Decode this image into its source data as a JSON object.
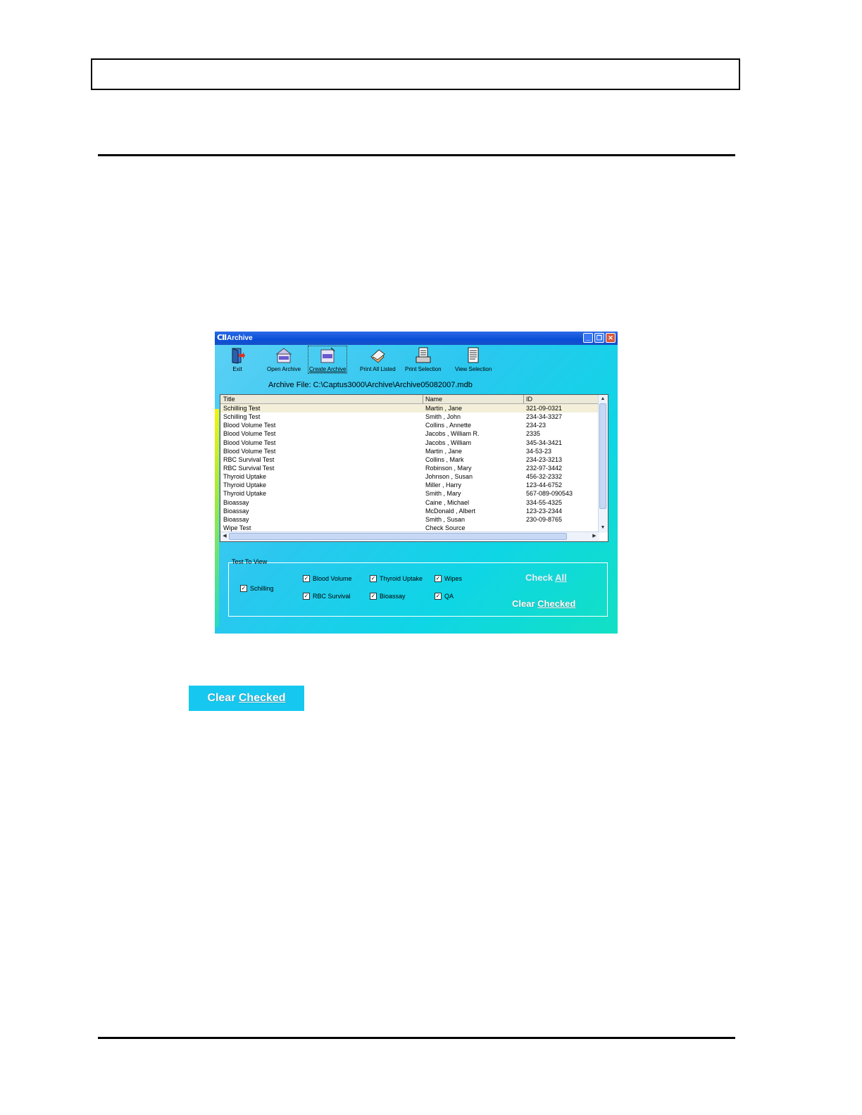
{
  "window": {
    "logo": "CII",
    "title": "Archive",
    "min_glyph": "_",
    "max_glyph": "❐",
    "close_glyph": "✕"
  },
  "toolbar": [
    {
      "label": "Exit",
      "icon": "exit-door-icon"
    },
    {
      "label": "Open Archive",
      "icon": "open-archive-icon"
    },
    {
      "label": "Create Archive",
      "icon": "create-archive-icon"
    },
    {
      "label": "Print All Listed",
      "icon": "print-all-icon"
    },
    {
      "label": "Print Selection",
      "icon": "print-selection-icon"
    },
    {
      "label": "View Selection",
      "icon": "view-selection-icon"
    }
  ],
  "archive_file": "Archive File: C:\\Captus3000\\Archive\\Archive05082007.mdb",
  "table": {
    "headers": [
      "Title",
      "Name",
      "ID"
    ],
    "rows": [
      [
        "Schilling Test",
        "Martin , Jane",
        "321-09-0321"
      ],
      [
        "Schilling Test",
        "Smith , John",
        "234-34-3327"
      ],
      [
        "Blood Volume Test",
        "Collins , Annette",
        "234-23"
      ],
      [
        "Blood Volume Test",
        "Jacobs , William R.",
        "2335"
      ],
      [
        "Blood Volume Test",
        "Jacobs , William",
        "345-34-3421"
      ],
      [
        "Blood Volume Test",
        "Martin , Jane",
        "34-53-23"
      ],
      [
        "RBC Survival Test",
        "Collins , Mark",
        "234-23-3213"
      ],
      [
        "RBC Survival Test",
        "Robinson , Mary",
        "232-97-3442"
      ],
      [
        "Thyroid Uptake",
        "Johnson , Susan",
        "456-32-2332"
      ],
      [
        "Thyroid Uptake",
        "Miller , Harry",
        "123-44-6752"
      ],
      [
        "Thyroid Uptake",
        "Smith , Mary",
        "567-089-090543"
      ],
      [
        "Bioassay",
        "Caine , Michael",
        "334-55-4325"
      ],
      [
        "Bioassay",
        "McDonald , Albert",
        "123-23-2344"
      ],
      [
        "Bioassay",
        "Smith , Susan",
        "230-09-8765"
      ],
      [
        "Wipe Test",
        "Check Source",
        ""
      ]
    ]
  },
  "test_to_view": {
    "label": "Test To View",
    "options": [
      {
        "label": "Schilling",
        "checked": true
      },
      {
        "label": "Blood Volume",
        "checked": true
      },
      {
        "label": "Thyroid Uptake",
        "checked": true
      },
      {
        "label": "Wipes",
        "checked": true
      },
      {
        "label": "RBC Survival",
        "checked": true
      },
      {
        "label": "Bioassay",
        "checked": true
      },
      {
        "label": "QA",
        "checked": true
      }
    ],
    "check_all_pre": "Check ",
    "check_all_key": "All",
    "clear_checked_pre": "Clear ",
    "clear_checked_key": "Checked"
  },
  "callout": {
    "pre": "Clear ",
    "key": "Checked"
  }
}
